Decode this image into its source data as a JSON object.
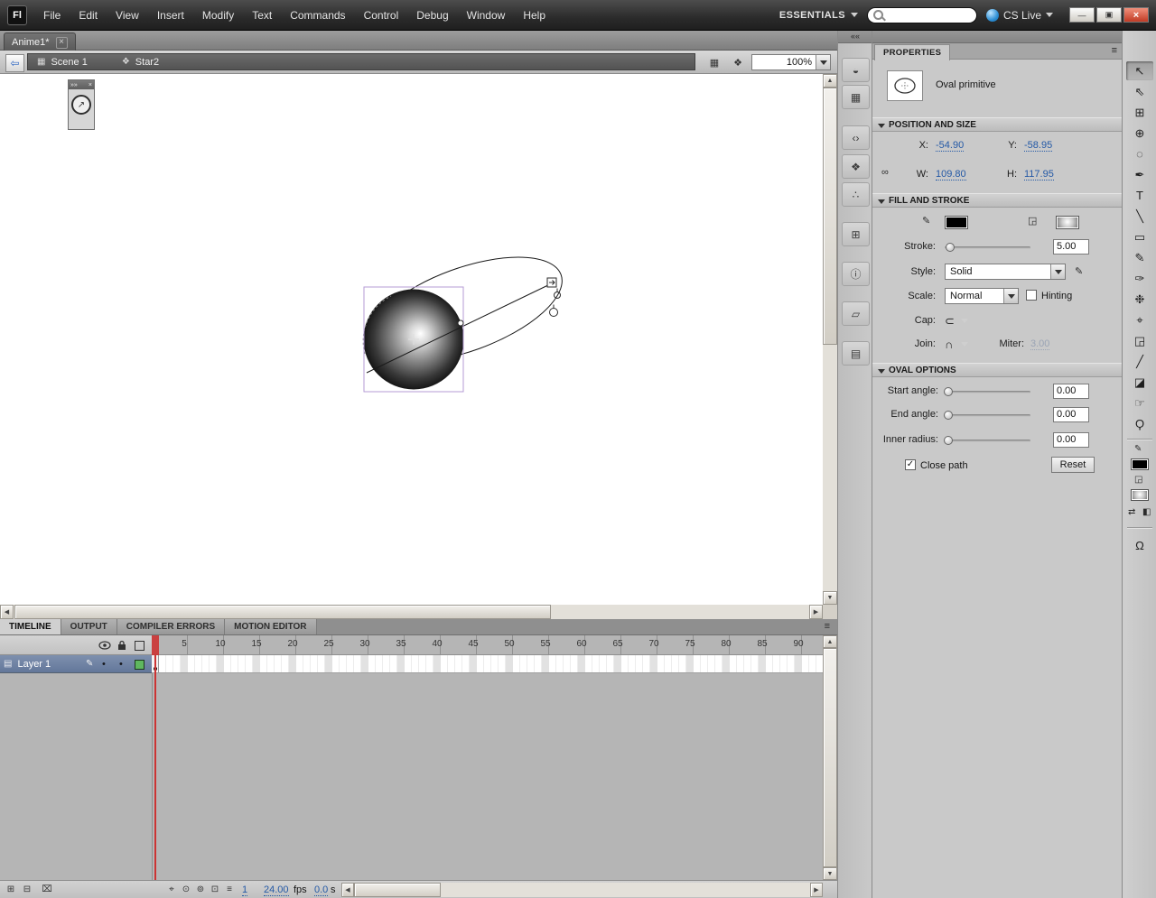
{
  "colors": {
    "accent_blue": "#2459a6",
    "selection_outline": "#b49bd6",
    "playhead_red": "#cc3333",
    "layer_selected": "#6f83a3",
    "layer_outline_green": "#5fb75f"
  },
  "menubar": {
    "logo": "Fl",
    "items": [
      "File",
      "Edit",
      "View",
      "Insert",
      "Modify",
      "Text",
      "Commands",
      "Control",
      "Debug",
      "Window",
      "Help"
    ],
    "workspace": "ESSENTIALS",
    "cs_live": "CS Live",
    "window": {
      "minimize": "—",
      "restore": "▣",
      "close": "×"
    }
  },
  "document": {
    "tab_label": "Anime1*",
    "tab_close": "×"
  },
  "edit_bar": {
    "back_glyph": "⇦",
    "scene_icon": "▦",
    "scene": "Scene 1",
    "symbol_icon": "❖",
    "symbol": "Star2",
    "edit_scene_icon": "▦",
    "edit_symbol_icon": "❖",
    "zoom": "100%"
  },
  "floating_panel": {
    "collapse_glyph": "»»",
    "close_glyph": "×",
    "button_glyph": "↗"
  },
  "dock": {
    "collapse_glyph": "««",
    "panels": [
      {
        "name": "color",
        "glyph": "◒"
      },
      {
        "name": "swatches",
        "glyph": "▦"
      },
      {
        "name": "code-snippets",
        "glyph": "‹›"
      },
      {
        "name": "components",
        "glyph": "❖"
      },
      {
        "name": "motion-presets",
        "glyph": "∴"
      },
      {
        "name": "align",
        "glyph": "⊞"
      },
      {
        "name": "info",
        "glyph": "ⓘ"
      },
      {
        "name": "transform",
        "glyph": "▱"
      },
      {
        "name": "library",
        "glyph": "▤"
      }
    ]
  },
  "properties": {
    "panel_tab": "PROPERTIES",
    "panel_menu": "≡",
    "object_type": "Oval primitive",
    "position_size": {
      "title": "POSITION AND SIZE",
      "x_label": "X:",
      "x_value": "-54.90",
      "y_label": "Y:",
      "y_value": "-58.95",
      "w_label": "W:",
      "w_value": "109.80",
      "h_label": "H:",
      "h_value": "117.95",
      "link_glyph": "∞"
    },
    "fill_stroke": {
      "title": "FILL AND STROKE",
      "stroke_pencil_glyph": "✎",
      "fill_bucket_glyph": "◲",
      "stroke_label": "Stroke:",
      "stroke_value": "5.00",
      "style_label": "Style:",
      "style_value": "Solid",
      "edit_style_glyph": "✎",
      "scale_label": "Scale:",
      "scale_value": "Normal",
      "hinting_label": "Hinting",
      "cap_label": "Cap:",
      "cap_glyph": "⊂",
      "join_label": "Join:",
      "join_glyph": "∩",
      "miter_label": "Miter:",
      "miter_value": "3.00"
    },
    "oval_options": {
      "title": "OVAL OPTIONS",
      "start_label": "Start angle:",
      "start_value": "0.00",
      "end_label": "End angle:",
      "end_value": "0.00",
      "inner_label": "Inner radius:",
      "inner_value": "0.00",
      "close_path_label": "Close path",
      "close_path_check": "✓",
      "reset_label": "Reset"
    }
  },
  "tools": {
    "items": [
      {
        "name": "selection-tool",
        "glyph": "↖"
      },
      {
        "name": "subselection-tool",
        "glyph": "⇖"
      },
      {
        "name": "free-transform-tool",
        "glyph": "⊞"
      },
      {
        "name": "3d-rotation-tool",
        "glyph": "⊕"
      },
      {
        "name": "lasso-tool",
        "glyph": "◌"
      },
      {
        "name": "pen-tool",
        "glyph": "✒"
      },
      {
        "name": "text-tool",
        "glyph": "T"
      },
      {
        "name": "line-tool",
        "glyph": "╲"
      },
      {
        "name": "rectangle-tool",
        "glyph": "▭"
      },
      {
        "name": "pencil-tool",
        "glyph": "✎"
      },
      {
        "name": "brush-tool",
        "glyph": "✑"
      },
      {
        "name": "deco-tool",
        "glyph": "❉"
      },
      {
        "name": "bone-tool",
        "glyph": "⌖"
      },
      {
        "name": "paint-bucket-tool",
        "glyph": "◲"
      },
      {
        "name": "eyedropper-tool",
        "glyph": "╱"
      },
      {
        "name": "eraser-tool",
        "glyph": "◪"
      },
      {
        "name": "hand-tool",
        "glyph": "☞"
      },
      {
        "name": "zoom-tool",
        "glyph": "Ϙ"
      }
    ],
    "stroke_icon": "✎",
    "fill_icon": "◲",
    "swap_icon": "⇄",
    "bw_icon": "◧",
    "snap_icon": "Ω"
  },
  "timeline": {
    "tabs": [
      "TIMELINE",
      "OUTPUT",
      "COMPILER ERRORS",
      "MOTION EDITOR"
    ],
    "panel_menu": "≡",
    "layer": {
      "name": "Layer 1",
      "doc_glyph": "▤",
      "pencil_glyph": "✎"
    },
    "frame_numbers": [
      "5",
      "10",
      "15",
      "20",
      "25",
      "30",
      "35",
      "40",
      "45",
      "50",
      "55",
      "60",
      "65",
      "70",
      "75",
      "80",
      "85",
      "90"
    ],
    "buttons": {
      "new_layer": "⊞",
      "new_folder": "⊟",
      "delete_layer": "⌧",
      "center_frame": "⌖",
      "onion_skin": "⊙",
      "onion_outlines": "⊚",
      "edit_multiple": "⊡",
      "modify_markers": "≡"
    },
    "status": {
      "current_frame": "1",
      "fps_value": "24.00",
      "fps_unit": "fps",
      "time_value": "0.0",
      "time_unit": "s"
    }
  }
}
